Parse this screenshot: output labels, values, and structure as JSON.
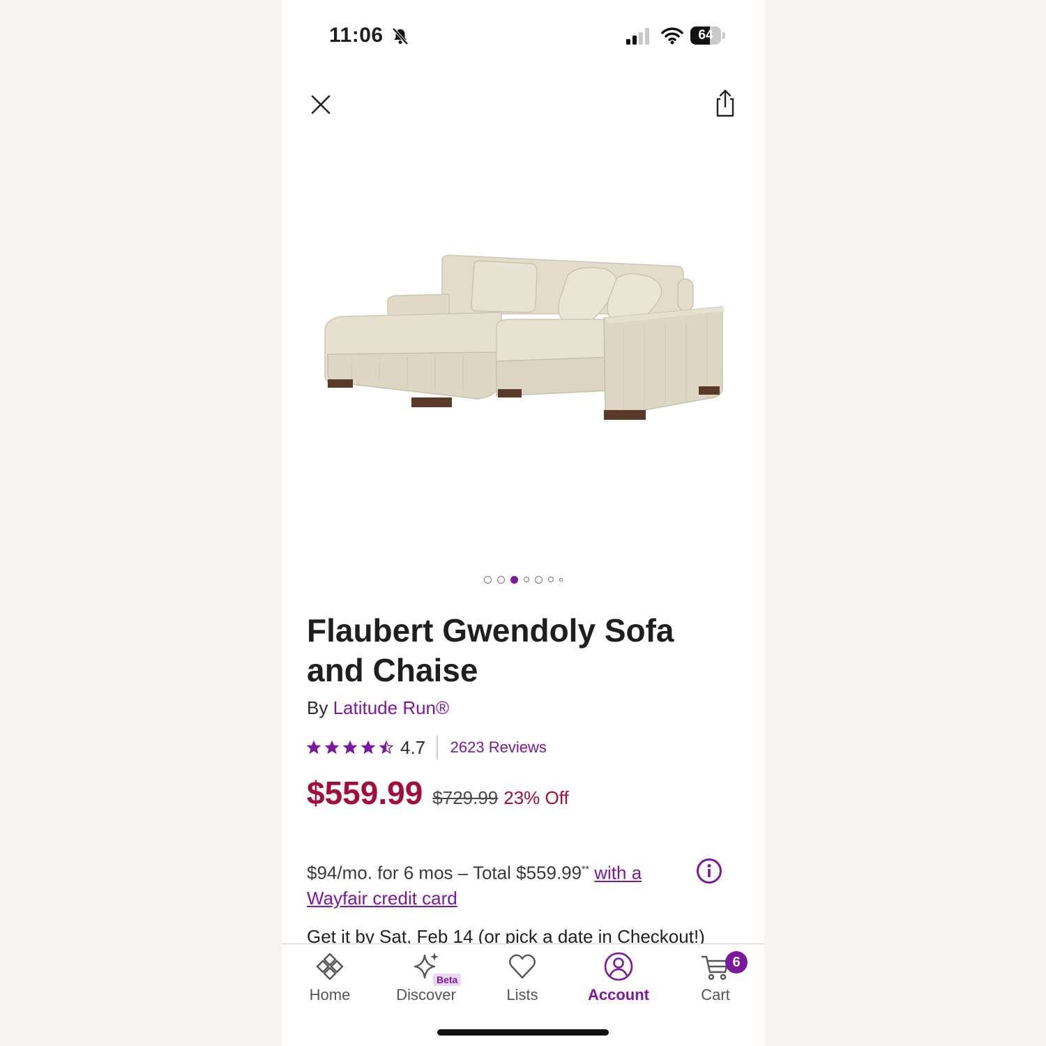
{
  "status_bar": {
    "time": "11:06",
    "battery": "64",
    "battery_level": 0.64
  },
  "product": {
    "title": "Flaubert Gwendoly Sofa and Chaise",
    "by_prefix": "By",
    "brand": "Latitude Run®",
    "rating": "4.7",
    "rating_stars": 4.5,
    "reviews": "2623 Reviews",
    "price": "$559.99",
    "original_price": "$729.99",
    "discount": "23% Off",
    "image_count": 7,
    "active_image_index": 2
  },
  "financing": {
    "text": "$94/mo. for 6 mos – Total $559.99",
    "footnote": "**",
    "link": "with a Wayfair credit card"
  },
  "delivery": {
    "text": "Get it by Sat, Feb 14 (or pick a date in Checkout!)"
  },
  "tabs": [
    {
      "label": "Home",
      "icon": "home-icon"
    },
    {
      "label": "Discover",
      "icon": "sparkle-icon",
      "badge": "Beta"
    },
    {
      "label": "Lists",
      "icon": "heart-icon"
    },
    {
      "label": "Account",
      "icon": "account-icon"
    },
    {
      "label": "Cart",
      "icon": "cart-icon",
      "badge": "6"
    }
  ],
  "colors": {
    "accent": "#7b189f",
    "price": "#a40d37",
    "sofa": "#ddd6c4"
  }
}
